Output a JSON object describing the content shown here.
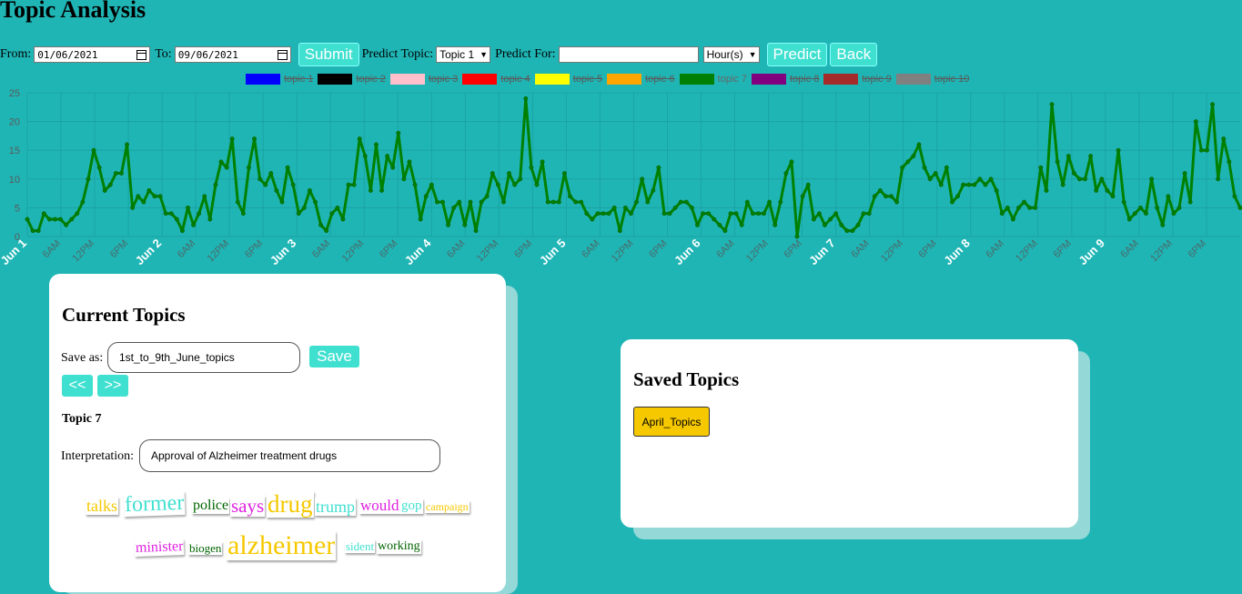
{
  "page_title": "Topic Analysis",
  "controls": {
    "from_label": "From:",
    "from_value": "01/06/2021",
    "to_label": "To:",
    "to_value": "09/06/2021",
    "submit_label": "Submit",
    "predict_topic_label": "Predict Topic:",
    "predict_topic_value": "Topic 1",
    "predict_for_label": "Predict For:",
    "predict_for_value": "",
    "unit_value": "Hour(s)",
    "predict_label": "Predict",
    "back_label": "Back"
  },
  "legend": [
    {
      "label": "topic 1",
      "color": "#0000ff",
      "active": false
    },
    {
      "label": "topic 2",
      "color": "#000000",
      "active": false
    },
    {
      "label": "topic 3",
      "color": "#ffc0cb",
      "active": false
    },
    {
      "label": "topic 4",
      "color": "#ff0000",
      "active": false
    },
    {
      "label": "topic 5",
      "color": "#ffff00",
      "active": false
    },
    {
      "label": "topic 6",
      "color": "#ffa500",
      "active": false
    },
    {
      "label": "topic 7",
      "color": "#008000",
      "active": true
    },
    {
      "label": "topic 8",
      "color": "#800080",
      "active": false
    },
    {
      "label": "topic 9",
      "color": "#a52a2a",
      "active": false
    },
    {
      "label": "topic 10",
      "color": "#808080",
      "active": false
    }
  ],
  "chart_data": {
    "type": "line",
    "series": [
      {
        "name": "topic 7",
        "color": "#008000"
      }
    ],
    "ylim": [
      0,
      25
    ],
    "yticks": [
      0,
      5,
      10,
      15,
      20,
      25
    ],
    "grid": true,
    "x_hours_per_point": 1,
    "y": [
      3,
      1,
      1,
      4,
      3,
      3,
      3,
      2,
      3,
      4,
      6,
      10,
      15,
      12,
      8,
      9,
      11,
      11,
      16,
      5,
      7,
      6,
      8,
      7,
      7,
      4,
      4,
      3,
      1,
      5,
      2,
      4,
      7,
      3,
      9,
      13,
      12,
      17,
      6,
      4,
      12,
      17,
      10,
      9,
      11,
      8,
      6,
      12,
      9,
      4,
      5,
      8,
      6,
      2,
      1,
      4,
      5,
      3,
      9,
      9,
      17,
      14,
      8,
      16,
      8,
      14,
      12,
      18,
      10,
      13,
      9,
      3,
      7,
      9,
      6,
      6,
      2,
      5,
      6,
      2,
      6,
      1,
      6,
      7,
      11,
      9,
      6,
      11,
      9,
      10,
      24,
      12,
      9,
      13,
      6,
      6,
      6,
      11,
      7,
      6,
      6,
      4,
      3,
      4,
      4,
      4,
      5,
      1,
      5,
      4,
      6,
      10,
      6,
      8,
      12,
      4,
      4,
      5,
      6,
      6,
      5,
      2,
      4,
      4,
      3,
      2,
      1,
      4,
      4,
      2,
      6,
      4,
      4,
      4,
      6,
      2,
      6,
      11,
      13,
      0,
      7,
      9,
      3,
      4,
      2,
      3,
      4,
      2,
      1,
      1,
      2,
      4,
      4,
      7,
      8,
      7,
      7,
      6,
      12,
      13,
      14,
      16,
      12,
      10,
      11,
      9,
      12,
      6,
      7,
      9,
      9,
      9,
      10,
      9,
      10,
      8,
      4,
      5,
      3,
      5,
      6,
      5,
      5,
      12,
      8,
      23,
      13,
      9,
      14,
      11,
      10,
      10,
      14,
      8,
      10,
      8,
      7,
      15,
      6,
      3,
      4,
      5,
      4,
      10,
      5,
      2,
      7,
      4,
      5,
      11,
      6,
      20,
      15,
      15,
      23,
      10,
      17,
      13,
      7,
      5
    ],
    "x_tick_labels": [
      {
        "label": "Jun 1",
        "major": true
      },
      {
        "label": "6AM",
        "major": false
      },
      {
        "label": "12PM",
        "major": false
      },
      {
        "label": "6PM",
        "major": false
      },
      {
        "label": "Jun 2",
        "major": true
      },
      {
        "label": "6AM",
        "major": false
      },
      {
        "label": "12PM",
        "major": false
      },
      {
        "label": "6PM",
        "major": false
      },
      {
        "label": "Jun 3",
        "major": true
      },
      {
        "label": "6AM",
        "major": false
      },
      {
        "label": "12PM",
        "major": false
      },
      {
        "label": "6PM",
        "major": false
      },
      {
        "label": "Jun 4",
        "major": true
      },
      {
        "label": "6AM",
        "major": false
      },
      {
        "label": "12PM",
        "major": false
      },
      {
        "label": "6PM",
        "major": false
      },
      {
        "label": "Jun 5",
        "major": true
      },
      {
        "label": "6AM",
        "major": false
      },
      {
        "label": "12PM",
        "major": false
      },
      {
        "label": "6PM",
        "major": false
      },
      {
        "label": "Jun 6",
        "major": true
      },
      {
        "label": "6AM",
        "major": false
      },
      {
        "label": "12PM",
        "major": false
      },
      {
        "label": "6PM",
        "major": false
      },
      {
        "label": "Jun 7",
        "major": true
      },
      {
        "label": "6AM",
        "major": false
      },
      {
        "label": "12PM",
        "major": false
      },
      {
        "label": "6PM",
        "major": false
      },
      {
        "label": "Jun 8",
        "major": true
      },
      {
        "label": "6AM",
        "major": false
      },
      {
        "label": "12PM",
        "major": false
      },
      {
        "label": "6PM",
        "major": false
      },
      {
        "label": "Jun 9",
        "major": true
      },
      {
        "label": "6AM",
        "major": false
      },
      {
        "label": "12PM",
        "major": false
      },
      {
        "label": "6PM",
        "major": false
      }
    ]
  },
  "current_topics": {
    "heading": "Current Topics",
    "save_as_label": "Save as:",
    "save_as_value": "1st_to_9th_June_topics",
    "save_label": "Save",
    "prev_label": "<<",
    "next_label": ">>",
    "topic_heading": "Topic 7",
    "interpretation_label": "Interpretation:",
    "interpretation_value": "Approval of Alzheimer treatment drugs",
    "word_cloud": [
      {
        "word": "talks",
        "color": "#f5c800"
      },
      {
        "word": "former",
        "color": "#40e0d0"
      },
      {
        "word": "police",
        "color": "#006400"
      },
      {
        "word": "says",
        "color": "#e020e0"
      },
      {
        "word": "drug",
        "color": "#f5c800"
      },
      {
        "word": "trump",
        "color": "#40e0d0"
      },
      {
        "word": "would",
        "color": "#e020e0"
      },
      {
        "word": "gop",
        "color": "#40e0d0"
      },
      {
        "word": "campaign",
        "color": "#f5c800"
      },
      {
        "word": "minister",
        "color": "#e020e0"
      },
      {
        "word": "biogen",
        "color": "#006400"
      },
      {
        "word": "alzheimer",
        "color": "#f5c800"
      },
      {
        "word": "sident",
        "color": "#40e0d0"
      },
      {
        "word": "working",
        "color": "#006400"
      }
    ]
  },
  "saved_topics": {
    "heading": "Saved Topics",
    "items": [
      "April_Topics"
    ]
  }
}
